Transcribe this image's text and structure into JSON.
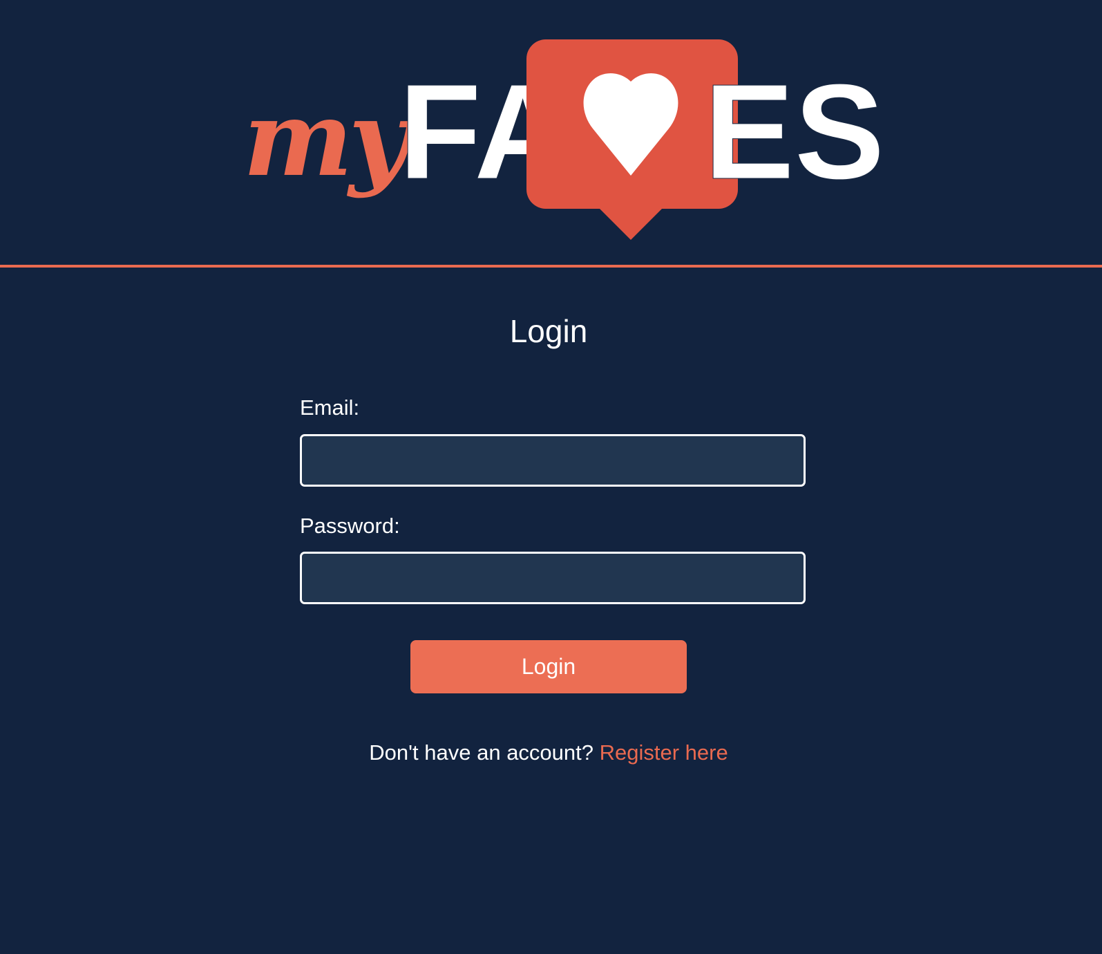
{
  "logo": {
    "prefix": "my",
    "word_left": "FA",
    "word_right": "ES",
    "heart_icon": "heart-icon",
    "accent_color": "#ea6a50"
  },
  "login": {
    "title": "Login",
    "email_label": "Email:",
    "email_value": "",
    "password_label": "Password:",
    "password_value": "",
    "submit_label": "Login"
  },
  "register": {
    "prompt": "Don't have an account?",
    "link_label": "Register here"
  },
  "colors": {
    "background": "#12233f",
    "accent": "#ea6a50",
    "input_background": "#213650",
    "text": "#ffffff"
  }
}
